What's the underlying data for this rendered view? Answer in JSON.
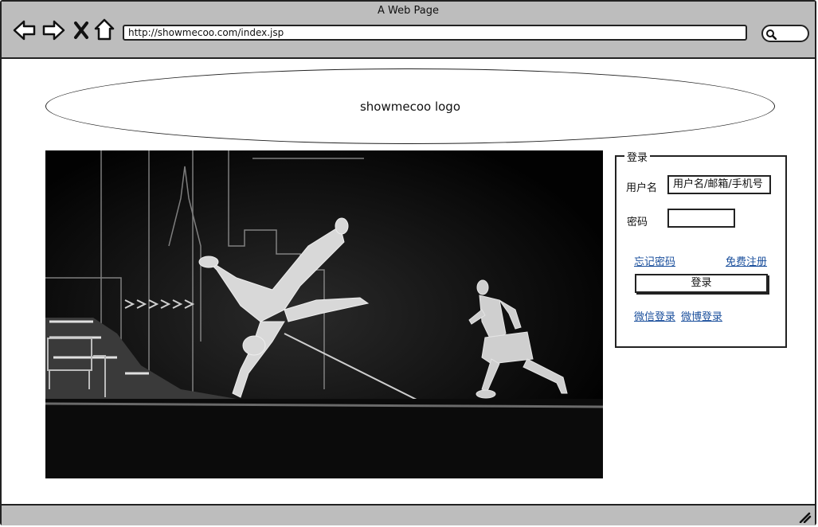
{
  "window": {
    "title": "A Web Page",
    "url": "http://showmecoo.com/index.jsp"
  },
  "logo": {
    "text": "showmecoo logo"
  },
  "hero": {
    "alt": "black-and-white stage photo of breakdancers"
  },
  "login": {
    "title": "登录",
    "username_label": "用户名",
    "username_value": "用户名/邮箱/手机号",
    "password_label": "密码",
    "password_value": "",
    "forgot_link": "忘记密码",
    "register_link": "免费注册",
    "submit_label": "登录",
    "wechat_link": "微信登录",
    "weibo_link": "微博登录"
  },
  "icons": [
    "back-icon",
    "forward-icon",
    "close-icon",
    "home-icon",
    "search-icon",
    "resize-grip-icon"
  ]
}
